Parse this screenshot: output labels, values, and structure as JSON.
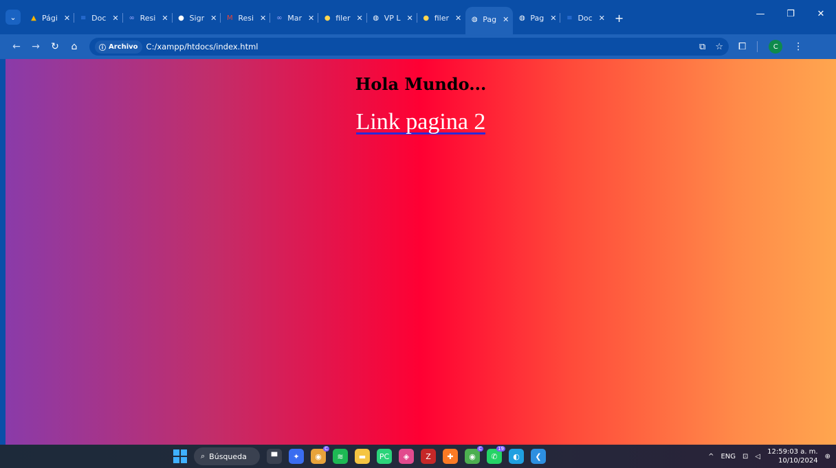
{
  "browser": {
    "tabs": [
      {
        "label": "Pági",
        "icon": "drive-icon",
        "color": "#f4b400",
        "active": false
      },
      {
        "label": "Doc",
        "icon": "docs-icon",
        "color": "#4285f4",
        "active": false
      },
      {
        "label": "Resi",
        "icon": "infinity-icon",
        "color": "#9aa7ff",
        "active": false
      },
      {
        "label": "Sigr",
        "icon": "github-icon",
        "color": "#ffffff",
        "active": false
      },
      {
        "label": "Resi",
        "icon": "gmail-icon",
        "color": "#ea4335",
        "active": false
      },
      {
        "label": "Mar",
        "icon": "infinity-icon",
        "color": "#9aa7ff",
        "active": false
      },
      {
        "label": "filer",
        "icon": "filezilla-icon",
        "color": "#ffd54f",
        "active": false
      },
      {
        "label": "VP L",
        "icon": "globe-icon",
        "color": "#ffffff",
        "active": false
      },
      {
        "label": "filer",
        "icon": "filezilla-icon",
        "color": "#ffd54f",
        "active": false
      },
      {
        "label": "Pag",
        "icon": "globe-icon",
        "color": "#ffffff",
        "active": true
      },
      {
        "label": "Pag",
        "icon": "globe-icon",
        "color": "#ffffff",
        "active": false
      },
      {
        "label": "Doc",
        "icon": "docs-icon",
        "color": "#4285f4",
        "active": false
      }
    ],
    "new_tab": "+",
    "address": {
      "chip_label": "Archivo",
      "url": "C:/xampp/htdocs/index.html"
    },
    "profile_initial": "C"
  },
  "page": {
    "title": "Hola Mundo...",
    "link_text": "Link pagina 2",
    "gradient": [
      "#8a3ba9",
      "#ff0033",
      "#ffa64f"
    ]
  },
  "taskbar": {
    "search_label": "Búsqueda",
    "apps": [
      {
        "name": "task-view-icon",
        "glyph": "▀",
        "color": "#3a4150"
      },
      {
        "name": "copilot-icon",
        "glyph": "✦",
        "color": "#3a6df0"
      },
      {
        "name": "chrome-icon",
        "glyph": "◉",
        "color": "#e8a33b",
        "badge": "C"
      },
      {
        "name": "spotify-icon",
        "glyph": "≋",
        "color": "#1db954"
      },
      {
        "name": "file-explorer-icon",
        "glyph": "▬",
        "color": "#f5c542"
      },
      {
        "name": "pycharm-icon",
        "glyph": "PC",
        "color": "#2bd47a"
      },
      {
        "name": "codepen-icon",
        "glyph": "◈",
        "color": "#e24a8d"
      },
      {
        "name": "filezilla-icon",
        "glyph": "Z",
        "color": "#c62828"
      },
      {
        "name": "xampp-icon",
        "glyph": "✚",
        "color": "#fb7a24"
      },
      {
        "name": "chrome-profile-icon",
        "glyph": "◉",
        "color": "#4caf50",
        "badge": "C"
      },
      {
        "name": "whatsapp-icon",
        "glyph": "✆",
        "color": "#25d366",
        "badge": "19"
      },
      {
        "name": "edge-icon",
        "glyph": "◐",
        "color": "#1fa0e0"
      },
      {
        "name": "vscode-icon",
        "glyph": "❮",
        "color": "#2d8fe0"
      }
    ],
    "tray": {
      "language": "ENG",
      "time": "12:59:03 a. m.",
      "date": "10/10/2024"
    }
  }
}
